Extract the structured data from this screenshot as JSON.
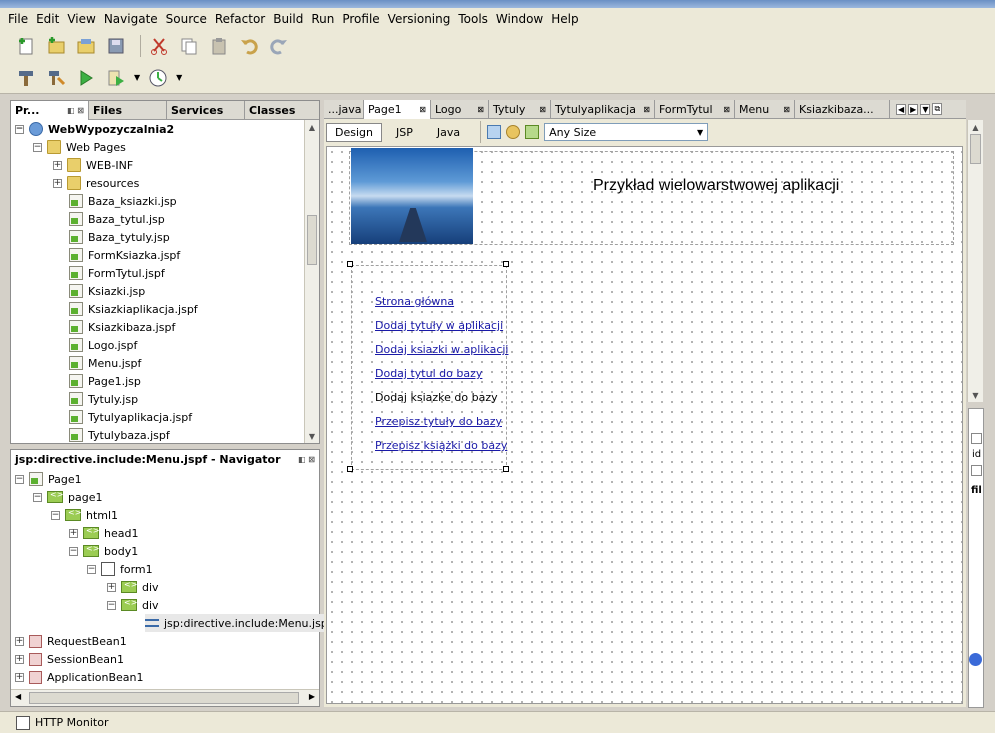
{
  "menu": [
    "File",
    "Edit",
    "View",
    "Navigate",
    "Source",
    "Refactor",
    "Build",
    "Run",
    "Profile",
    "Versioning",
    "Tools",
    "Window",
    "Help"
  ],
  "project_tabs": [
    "Pr...",
    "Files",
    "Services",
    "Classes"
  ],
  "project_tree": {
    "root": "WebWypozyczalnia2",
    "web_pages": "Web Pages",
    "folders": [
      "WEB-INF",
      "resources"
    ],
    "files": [
      "Baza_ksiazki.jsp",
      "Baza_tytul.jsp",
      "Baza_tytuly.jsp",
      "FormKsiazka.jspf",
      "FormTytul.jspf",
      "Ksiazki.jsp",
      "Ksiazkiaplikacja.jspf",
      "Ksiazkibaza.jspf",
      "Logo.jspf",
      "Menu.jspf",
      "Page1.jsp",
      "Tytuly.jsp",
      "Tytulyaplikacja.jspf",
      "Tytulybaza.jspf"
    ]
  },
  "navigator": {
    "title": "jsp:directive.include:Menu.jspf - Navigator",
    "nodes": [
      "Page1",
      "page1",
      "html1",
      "head1",
      "body1",
      "form1",
      "div",
      "div",
      "jsp:directive.include:Menu.jspf",
      "RequestBean1",
      "SessionBean1",
      "ApplicationBean1"
    ]
  },
  "editor_tabs": [
    "...java",
    "Page1",
    "Logo",
    "Tytuly",
    "Tytulyaplikacja",
    "FormTytul",
    "Menu",
    "Ksiazkibaza..."
  ],
  "view_tabs": [
    "Design",
    "JSP",
    "Java"
  ],
  "size_select": "Any Size",
  "design": {
    "heading": "Przykład wielowarstwowej aplikacji",
    "menu_links": [
      "Strona główna",
      "Dodaj tytuły w aplikacji",
      "Dodaj ksiazki w aplikacji",
      "Dodaj tytul do bazy"
    ],
    "menu_plain": "Dodaj ksiazke do bazy",
    "menu_links2": [
      "Przepisz tytuły do bazy",
      "Przepisz książki do bazy"
    ]
  },
  "right_panel": [
    "id",
    "fil"
  ],
  "status": "HTTP Monitor",
  "colors": {
    "link": "#1a1aa8",
    "header_bg": "#ece9d8",
    "panel_border": "#8d8d8d"
  }
}
